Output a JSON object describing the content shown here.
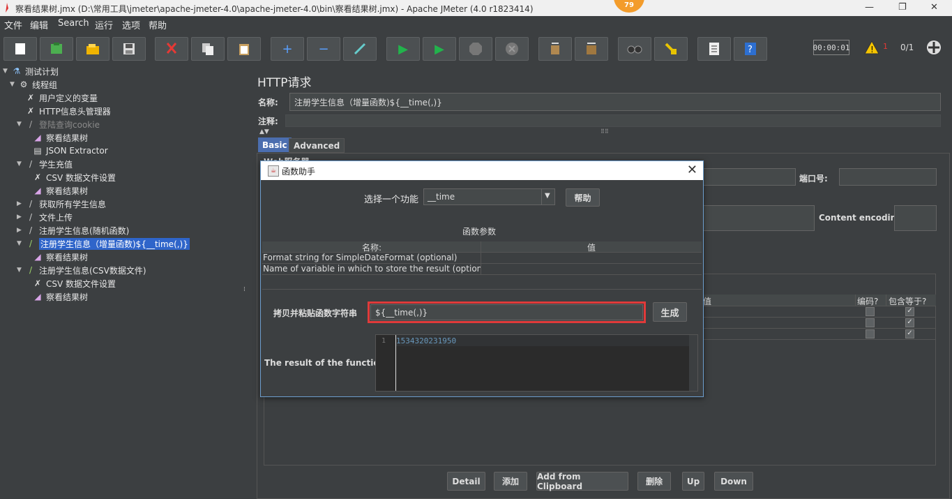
{
  "window": {
    "title": "察看结果树.jmx (D:\\常用工具\\jmeter\\apache-jmeter-4.0\\apache-jmeter-4.0\\bin\\察看结果树.jmx) - Apache JMeter (4.0 r1823414)",
    "badge": "79",
    "minimize": "—",
    "restore": "❐",
    "close": "✕"
  },
  "menu": [
    "文件",
    "编辑",
    "Search",
    "运行",
    "选项",
    "帮助"
  ],
  "toolbar": {
    "timer": "00:00:01",
    "warning_count": "1",
    "threads": "0/1",
    "icons": [
      "new-icon",
      "templates-icon",
      "open-icon",
      "save-icon",
      "cut-icon",
      "copy-icon",
      "paste-icon",
      "expand-icon",
      "collapse-icon",
      "toggle-icon",
      "start-icon",
      "start-no-pause-icon",
      "stop-icon",
      "shutdown-icon",
      "clear-icon",
      "clear-all-icon",
      "search-icon",
      "reset-search-icon",
      "function-helper-icon",
      "help-icon"
    ]
  },
  "tree": [
    {
      "label": "测试计划",
      "level": 0,
      "expander": "▼",
      "icon": "test-plan-icon",
      "glyph": "⚗",
      "color": "#8ec5ff"
    },
    {
      "label": "线程组",
      "level": 1,
      "expander": "▼",
      "icon": "thread-group-icon",
      "glyph": "⚙",
      "color": "#ddd"
    },
    {
      "label": "用户定义的变量",
      "level": 2,
      "expander": "",
      "icon": "config-element-icon",
      "glyph": "✗",
      "color": "#ddd"
    },
    {
      "label": "HTTP信息头管理器",
      "level": 2,
      "expander": "",
      "icon": "config-element-icon",
      "glyph": "✗",
      "color": "#ddd"
    },
    {
      "label": "登陆查询cookie",
      "level": 2,
      "expander": "▼",
      "icon": "sampler-icon",
      "glyph": "/",
      "color": "#aaa",
      "disabled": true
    },
    {
      "label": "察看结果树",
      "level": 3,
      "expander": "",
      "icon": "listener-icon",
      "glyph": "◢",
      "color": "#d9a5e8"
    },
    {
      "label": "JSON Extractor",
      "level": 3,
      "expander": "",
      "icon": "post-processor-icon",
      "glyph": "▤",
      "color": "#ddd"
    },
    {
      "label": "学生充值",
      "level": 2,
      "expander": "▼",
      "icon": "sampler-icon",
      "glyph": "/",
      "color": "#ccc"
    },
    {
      "label": "CSV 数据文件设置",
      "level": 3,
      "expander": "",
      "icon": "config-element-icon",
      "glyph": "✗",
      "color": "#ddd"
    },
    {
      "label": "察看结果树",
      "level": 3,
      "expander": "",
      "icon": "listener-icon",
      "glyph": "◢",
      "color": "#d9a5e8"
    },
    {
      "label": "获取所有学生信息",
      "level": 2,
      "expander": "▶",
      "icon": "sampler-icon",
      "glyph": "/",
      "color": "#ccc"
    },
    {
      "label": "文件上传",
      "level": 2,
      "expander": "▶",
      "icon": "sampler-icon",
      "glyph": "/",
      "color": "#ccc"
    },
    {
      "label": "注册学生信息(随机函数)",
      "level": 2,
      "expander": "▶",
      "icon": "sampler-icon",
      "glyph": "/",
      "color": "#ccc"
    },
    {
      "label": "注册学生信息（增量函数)${__time(,)}",
      "level": 2,
      "expander": "▼",
      "icon": "sampler-icon",
      "glyph": "/",
      "color": "#9fd66b",
      "selected": true
    },
    {
      "label": "察看结果树",
      "level": 3,
      "expander": "",
      "icon": "listener-icon",
      "glyph": "◢",
      "color": "#d9a5e8"
    },
    {
      "label": "注册学生信息(CSV数据文件)",
      "level": 2,
      "expander": "▼",
      "icon": "sampler-icon",
      "glyph": "/",
      "color": "#9fd66b"
    },
    {
      "label": "CSV 数据文件设置",
      "level": 3,
      "expander": "",
      "icon": "config-element-icon",
      "glyph": "✗",
      "color": "#ddd"
    },
    {
      "label": "察看结果树",
      "level": 3,
      "expander": "",
      "icon": "listener-icon",
      "glyph": "◢",
      "color": "#d9a5e8"
    }
  ],
  "panel": {
    "title": "HTTP请求",
    "name_label": "名称:",
    "name_value": "注册学生信息（增量函数)${__time(,)}",
    "comment_label": "注释:",
    "comment_value": "",
    "tabs": [
      "Basic",
      "Advanced"
    ],
    "web_server_label": "Web服务器",
    "port_label": "端口号:",
    "content_encoding_label": "Content encoding:",
    "param_headers": [
      "值",
      "编码?",
      "包含等于?"
    ],
    "bottom_buttons": [
      "Detail",
      "添加",
      "Add from Clipboard",
      "删除",
      "Up",
      "Down"
    ]
  },
  "dialog": {
    "title": "函数助手",
    "select_label": "选择一个功能",
    "selected_function": "__time",
    "help_button": "帮助",
    "params_title": "函数参数",
    "param_columns": [
      "名称:",
      "值"
    ],
    "params": [
      {
        "name": "Format string for SimpleDateFormat (optional)",
        "value": ""
      },
      {
        "name": "Name of variable in which to store the result (optional)",
        "value": ""
      }
    ],
    "copy_label": "拷贝并粘贴函数字符串",
    "function_string": "${__time(,)}",
    "generate_button": "生成",
    "result_label": "The result of the function is",
    "result_line_number": "1",
    "result_value": "1534320231950"
  }
}
